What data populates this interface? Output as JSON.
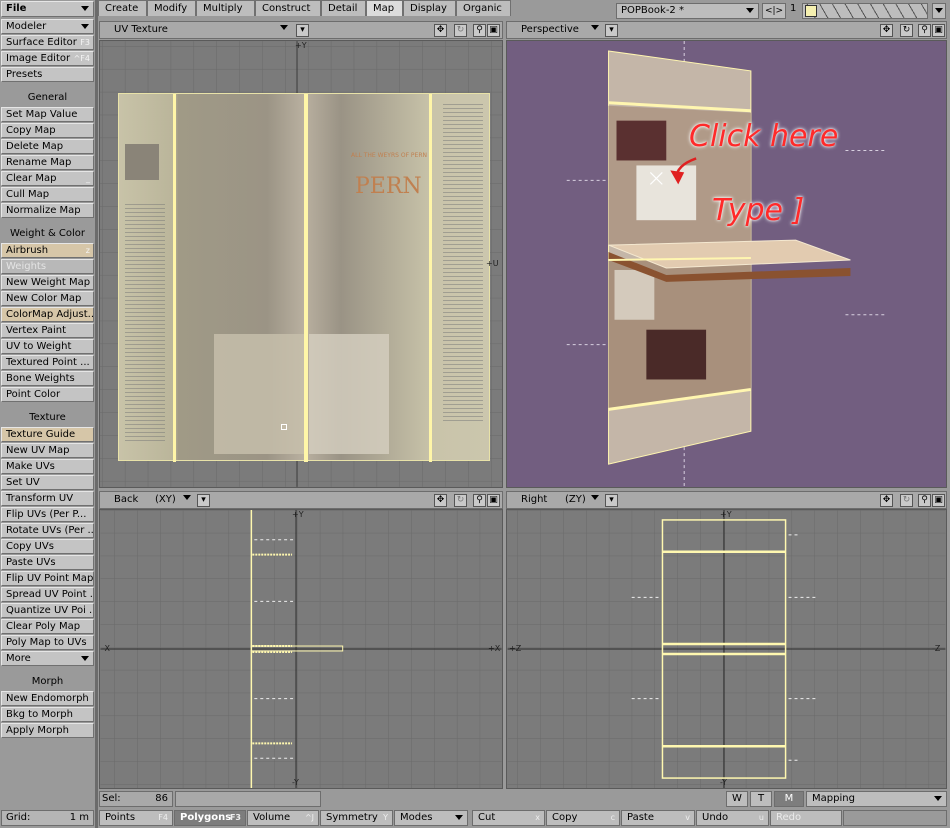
{
  "sidebar": {
    "file": "File",
    "modeler": "Modeler",
    "surface_editor": "Surface Editor",
    "surface_editor_key": "F3",
    "image_editor": "Image Editor",
    "image_editor_key": "^F4",
    "presets": "Presets",
    "general": "General",
    "set_map_value": "Set Map Value",
    "copy_map": "Copy Map",
    "delete_map": "Delete Map",
    "rename_map": "Rename Map",
    "clear_map": "Clear Map",
    "clear_map_key": "_",
    "cull_map": "Cull Map",
    "normalize_map": "Normalize Map",
    "weight_color": "Weight & Color",
    "airbrush": "Airbrush",
    "airbrush_key": "z",
    "weights": "Weights",
    "new_weight_map": "New Weight Map",
    "new_color_map": "New Color Map",
    "colormap_adjust": "ColorMap Adjust...",
    "vertex_paint": "Vertex Paint",
    "uv_to_weight": "UV to Weight",
    "textured_point": "Textured Point ...",
    "bone_weights": "Bone Weights",
    "point_color": "Point Color",
    "texture": "Texture",
    "texture_guide": "Texture Guide",
    "new_uv_map": "New UV Map",
    "make_uvs": "Make UVs",
    "set_uv": "Set UV",
    "transform_uv": "Transform UV",
    "flip_uvs": "Flip UVs (Per P...",
    "rotate_uvs": "Rotate UVs (Per ...",
    "copy_uvs": "Copy UVs",
    "paste_uvs": "Paste UVs",
    "flip_uv_point_map": "Flip UV Point Map",
    "spread_uv_point": "Spread UV Point ...",
    "quantize_uv": "Quantize UV Poi ...",
    "clear_poly_map": "Clear Poly Map",
    "poly_map_to_uvs": "Poly Map to UVs",
    "more": "More",
    "morph": "Morph",
    "new_endomorph": "New Endomorph",
    "bkg_to_morph": "Bkg to Morph",
    "apply_morph": "Apply Morph",
    "grid_label": "Grid:",
    "grid_value": "1 m"
  },
  "tabs": [
    "Create",
    "Modify",
    "Multiply",
    "Construct",
    "Detail",
    "Map",
    "Display",
    "Organic"
  ],
  "object": {
    "name": "POPBook-2 *",
    "layer": "1"
  },
  "viewports": {
    "uv": {
      "title": "UV Texture",
      "top_label": "+Y",
      "right_label": "+U"
    },
    "persp": {
      "title": "Perspective",
      "annot1": "Click here",
      "annot2": "Type ]"
    },
    "back": {
      "title": "Back",
      "mode": "(XY)",
      "axis_top": "+Y",
      "axis_bottom": "-Y",
      "axis_left": "-X",
      "axis_right": "+X"
    },
    "right": {
      "title": "Right",
      "mode": "(ZY)",
      "axis_top": "+Y",
      "axis_bottom": "-Y",
      "axis_left": "+Z",
      "axis_right": "-Z"
    }
  },
  "book": {
    "title": "PERN",
    "subtitle": "ALL THE WEYRS OF PERN"
  },
  "status": {
    "sel_label": "Sel:",
    "sel_value": "86",
    "w": "W",
    "t": "T",
    "m": "M",
    "mapping": "Mapping"
  },
  "bottom": {
    "points": "Points",
    "points_key": "F4",
    "polygons": "Polygons",
    "polygons_key": "F3",
    "volume": "Volume",
    "volume_key": "^J",
    "symmetry": "Symmetry",
    "symmetry_key": "Y",
    "modes": "Modes",
    "cut": "Cut",
    "cut_key": "x",
    "copy": "Copy",
    "copy_key": "c",
    "paste": "Paste",
    "paste_key": "v",
    "undo": "Undo",
    "undo_key": "u",
    "redo": "Redo"
  },
  "colors": {
    "persp_bg": "#725e80",
    "grid_bg": "#7b7b7b",
    "annotation": "#ff2a2a",
    "selection": "#fff8b0"
  }
}
